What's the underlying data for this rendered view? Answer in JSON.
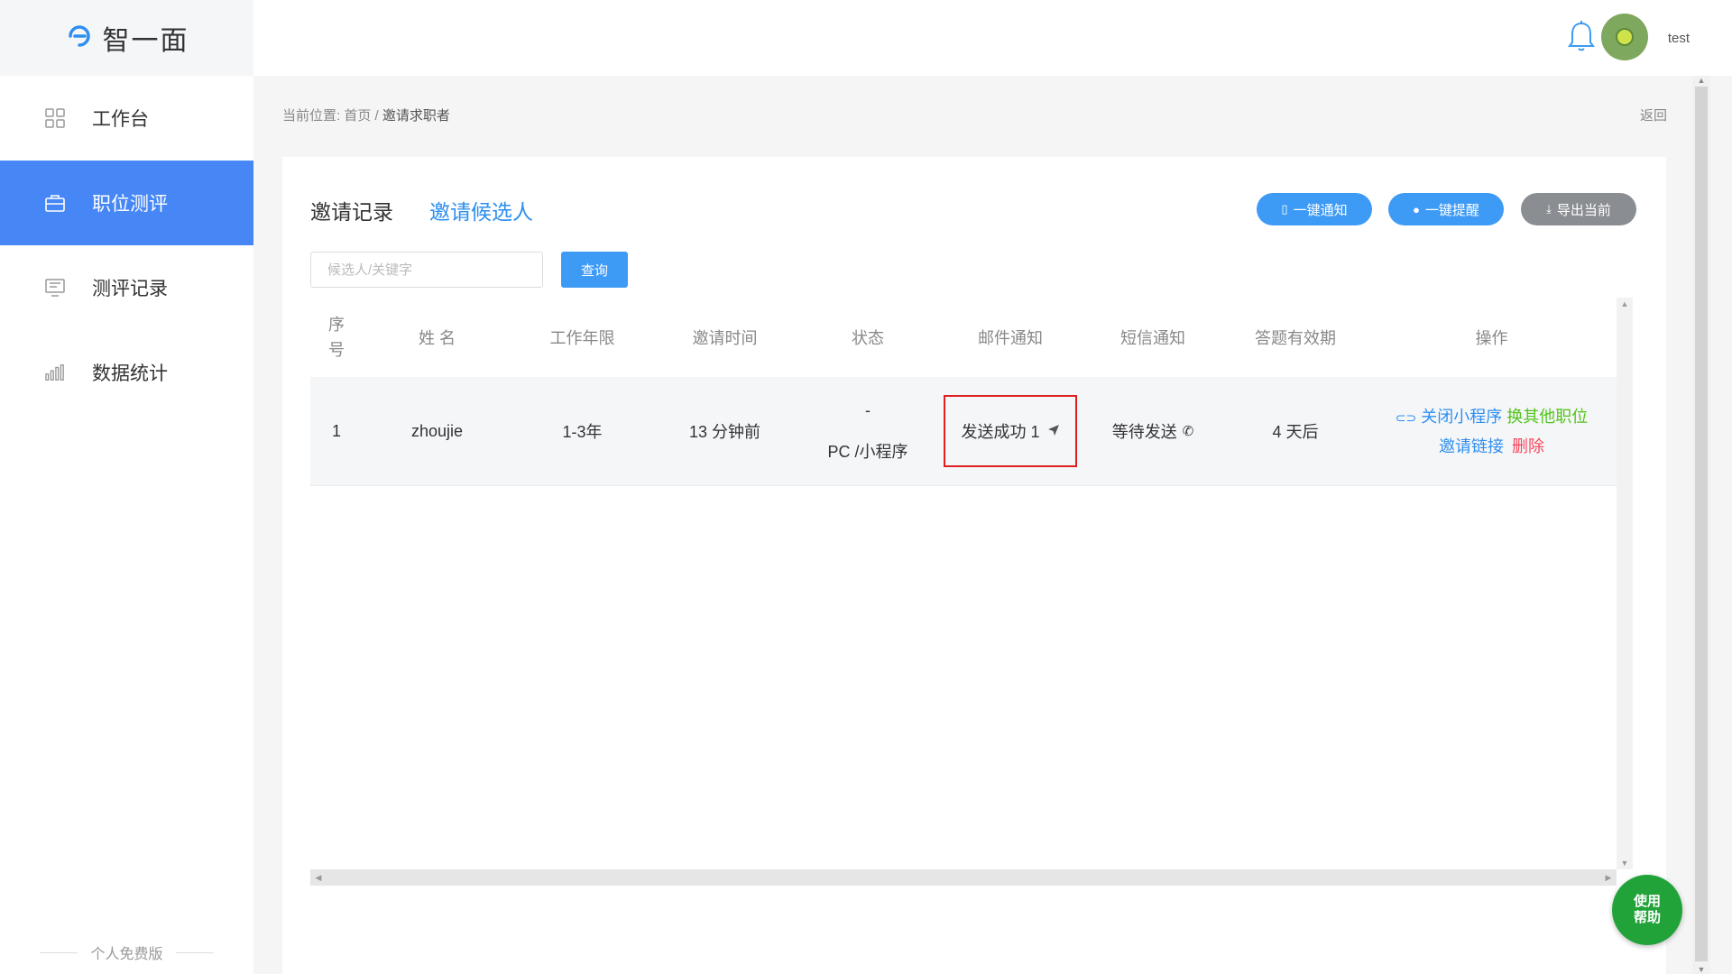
{
  "app": {
    "logo_text": "智一面"
  },
  "sidebar": {
    "items": [
      {
        "label": "工作台",
        "icon": "grid-icon",
        "active": false
      },
      {
        "label": "职位测评",
        "icon": "briefcase-icon",
        "active": true
      },
      {
        "label": "测评记录",
        "icon": "record-list-icon",
        "active": false
      },
      {
        "label": "数据统计",
        "icon": "bar-chart-icon",
        "active": false
      }
    ],
    "footer_label": "个人免费版"
  },
  "topbar": {
    "username": "test"
  },
  "breadcrumb": {
    "prefix": "当前位置:",
    "home": "首页",
    "separator": "/",
    "current": "邀请求职者"
  },
  "back_label": "返回",
  "tabs": {
    "active_label": "邀请记录",
    "link_label": "邀请候选人"
  },
  "actions": {
    "notify_label": "一键通知",
    "remind_label": "一键提醒",
    "export_label": "导出当前"
  },
  "search": {
    "placeholder": "候选人/关键字",
    "query_label": "查询"
  },
  "table": {
    "headers": {
      "index_line1": "序",
      "index_line2": "号",
      "name": "姓 名",
      "years": "工作年限",
      "invite_time": "邀请时间",
      "status": "状态",
      "email": "邮件通知",
      "sms": "短信通知",
      "validity": "答题有效期",
      "ops": "操作"
    },
    "rows": [
      {
        "index": "1",
        "name": "zhoujie",
        "years": "1-3年",
        "invite_time": "13 分钟前",
        "status_line1": "-",
        "status_line2": "PC /小程序",
        "email": "发送成功 1",
        "sms": "等待发送",
        "validity": "4 天后",
        "op_close": "关闭小程序",
        "op_change": "换其他职位",
        "op_link": "邀请链接",
        "op_delete": "删除"
      }
    ]
  },
  "help_label_line1": "使用",
  "help_label_line2": "帮助",
  "colors": {
    "primary": "#4687f5",
    "link": "#2e8ff0",
    "success": "#52c41a",
    "danger": "#f5475c",
    "help": "#22a33a"
  }
}
